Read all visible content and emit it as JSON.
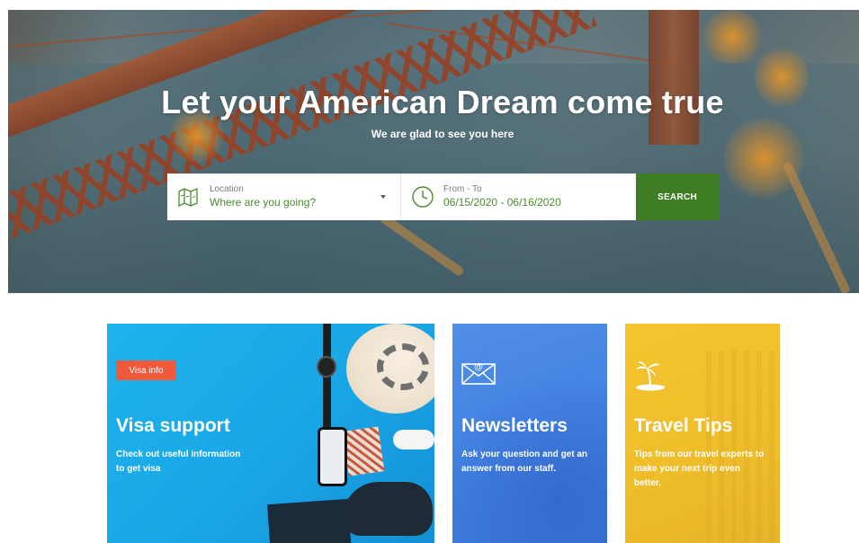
{
  "hero": {
    "title": "Let your American Dream come true",
    "subtitle": "We are glad to see you here"
  },
  "search": {
    "location_label": "Location",
    "location_value": "Where are you going?",
    "dates_label": "From - To",
    "dates_value": "06/15/2020 - 06/16/2020",
    "button_label": "SEARCH"
  },
  "cards": [
    {
      "badge": "Visa info",
      "title": "Visa support",
      "text_line1": "Check out useful information",
      "text_line2": "to get visa",
      "icon": "none"
    },
    {
      "title": "Newsletters",
      "text": "Ask your question and get an answer from our staff.",
      "icon": "envelope-icon"
    },
    {
      "title": "Travel Tips",
      "text": "Tips from our travel experts to make your next trip even better.",
      "icon": "palm-island-icon"
    }
  ],
  "colors": {
    "search_button": "#3f7d24",
    "field_value": "#4a8a2c",
    "badge": "#f05a3a",
    "visa_card": "#1eb2ec",
    "news_card": "#4a88e6",
    "tips_card": "#f2c52e"
  }
}
